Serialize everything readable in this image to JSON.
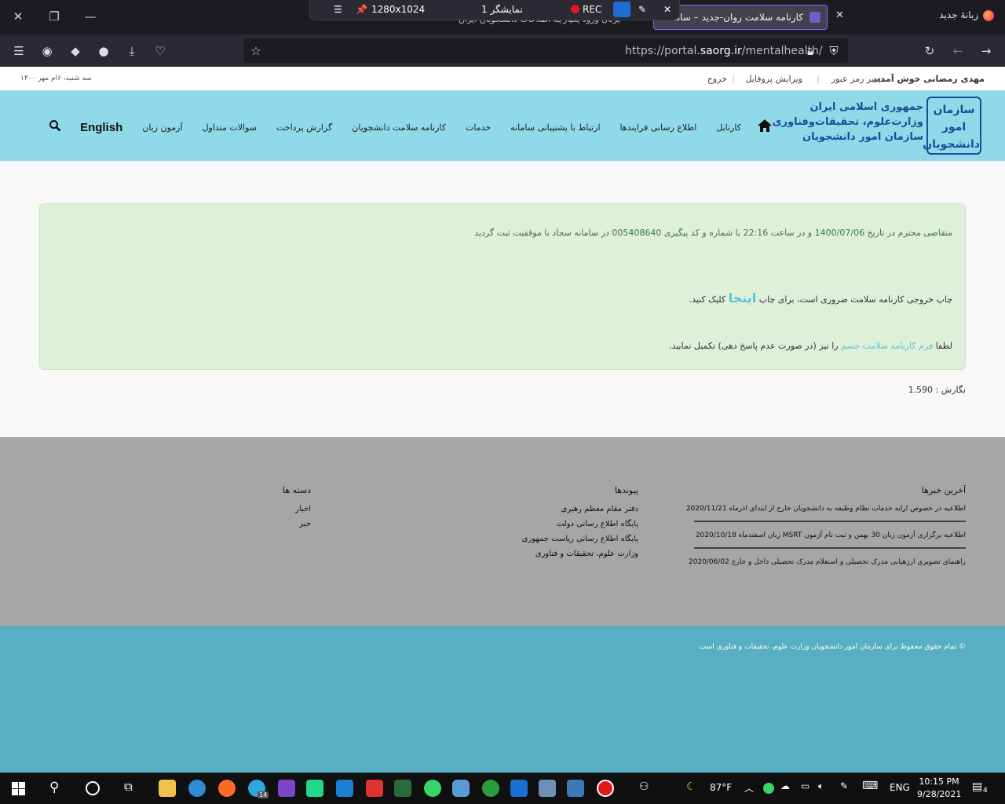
{
  "browser": {
    "active_tab_title": "کارنامه سلامت روان-جدید – سامانه",
    "second_tab_title": "زبانهٔ جدید",
    "partial_tab_text": "پرتال ورود یکپارچه اطلاعات دانشجویان ایران",
    "url_prefix": "https://portal.",
    "url_domain": "saorg.ir",
    "url_path": "/mentalhealth/"
  },
  "recorder": {
    "resolution": "1280x1024",
    "display": "نمایشگر 1",
    "rec_label": "REC"
  },
  "userbar": {
    "welcome": "مهدی رمضانی خوش آمدید",
    "change_password": "تغییر رمز عبور",
    "edit_profile": "ویرایش پروفایل",
    "logout": "خروج",
    "date": "سه شنبه، ۶ام مهر ۱۴۰۰"
  },
  "header": {
    "logo_mark": "سازمان امور دانشجویان",
    "logo_line1": "جمهوری اسلامی ایران",
    "logo_line2": "وزارت‌علوم، تحقیقات‌وفناوری",
    "logo_line3": "سازمان امور دانشجویان",
    "menu": [
      "کارتابل",
      "اطلاع رسانی فرایندها",
      "ارتباط با پشتیبانی سامانه",
      "خدمات",
      "کارنامه سلامت دانشجویان",
      "گزارش پرداخت",
      "سوالات متداول",
      "آزمون زبان"
    ],
    "english": "English"
  },
  "alert": {
    "line1": "متقاضی محترم در تاریخ 1400/07/06 و در ساعت 22:16 با شماره و کد پیگیری 005408640 در سامانه سجاد با موفقیت ثبت گردید",
    "line2_pre": "چاپ خروجی کارنامه سلامت ضروری است، برای چاپ",
    "line2_link": "اینجا",
    "line2_post": "کلیک کنید.",
    "line3_pre": "لطفا",
    "line3_link": "فرم کارنامه سلامت جسم",
    "line3_post": "را نیز (در صورت عدم پاسخ دهی) تکمیل نمایید."
  },
  "version": "نگارش : 1.590",
  "footer": {
    "news_title": "آخرین خبرها",
    "news": [
      "اطلاعیه در خصوص ارایه خدمات نظام وظیفه به دانشجویان خارج از ابتدای اذرماه 2020/11/21",
      "اطلاعیه برگزاری آزمون زبان 30 بهمن و ثبت نام آزمون MSRT زبان اسفندماه 2020/10/18",
      "راهنمای تصویری ارزهیابی مدرک تحصیلی و استعلام مدرک تحصیلی داخل و خارج 2020/06/02"
    ],
    "links_title": "پیوندها",
    "links": [
      "دفتر مقام معظم رهبری",
      "پایگاه اطلاع رسانی دولت",
      "پایگاه اطلاع رسانی ریاست جمهوری",
      "وزارت علوم، تحقیقات و فناوری"
    ],
    "categories_title": "دسته ها",
    "categories": [
      "اخبار",
      "خبر"
    ],
    "copyright": "© تمام حقوق محفوظ برای سازمان امور دانشجویان وزارت علوم، تحقیقات و فناوری است"
  },
  "taskbar": {
    "temperature": "87°F",
    "language": "ENG",
    "time": "10:15 PM",
    "date": "9/28/2021",
    "notifications": "4",
    "telegram_badge": "14"
  }
}
